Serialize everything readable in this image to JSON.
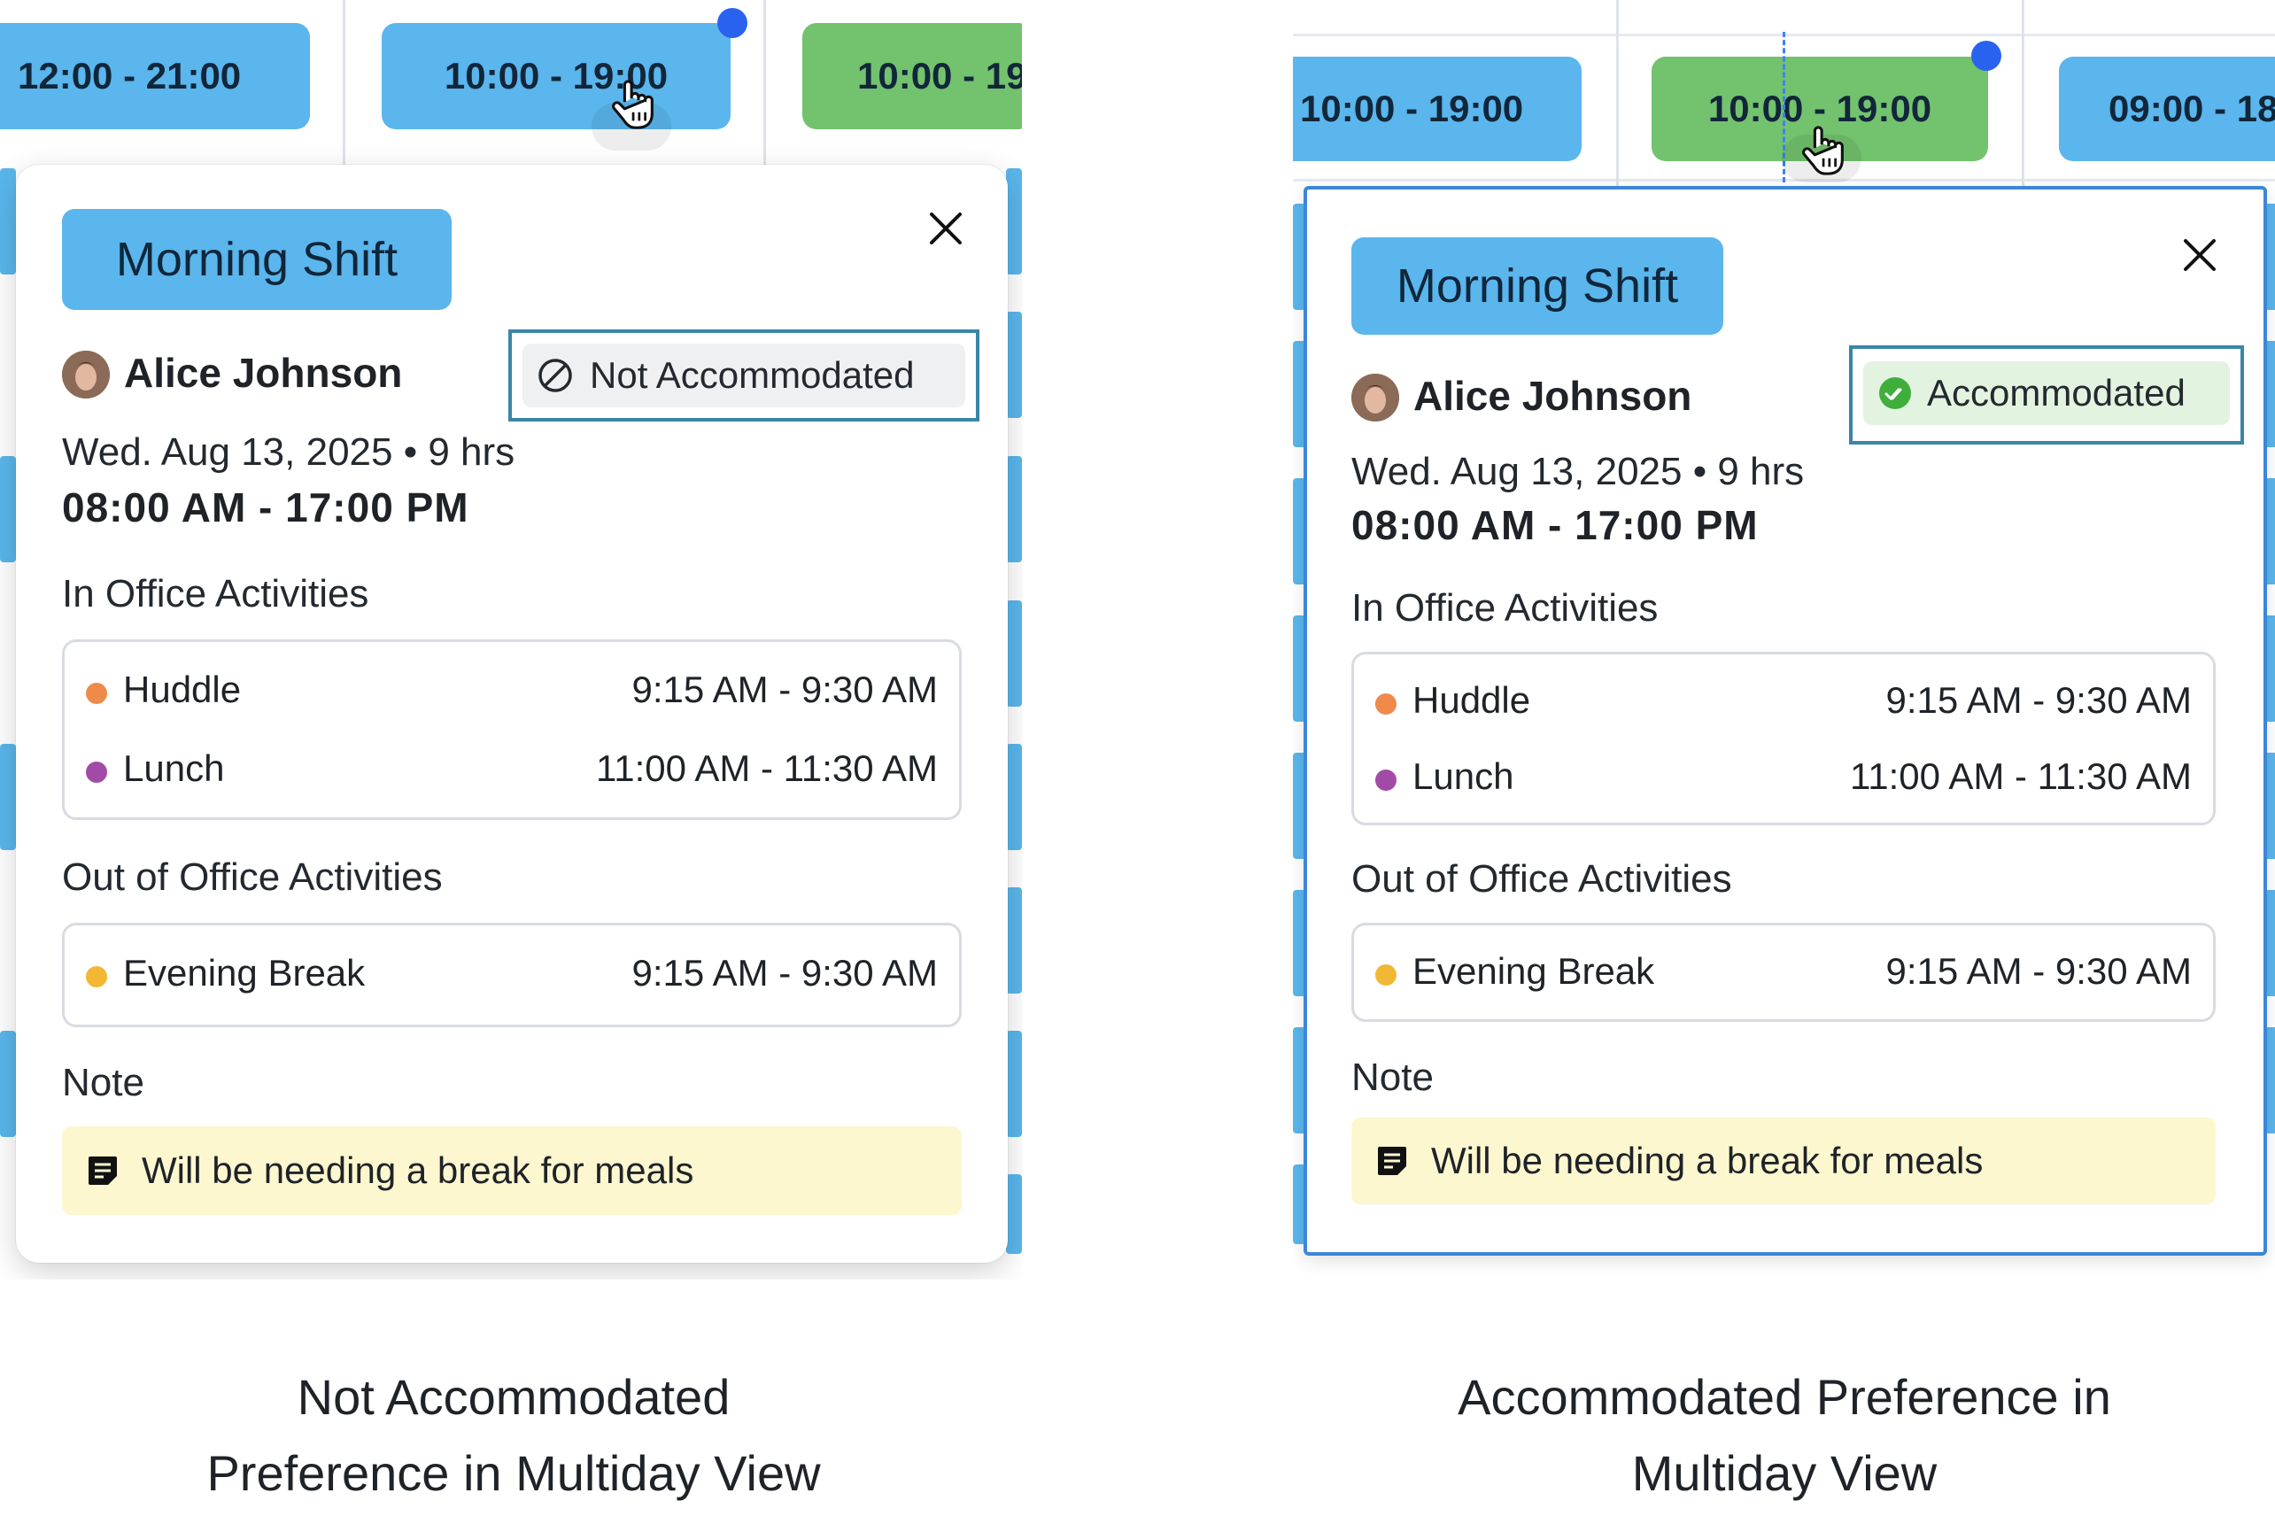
{
  "colors": {
    "shift_blue": "#5ab6ec",
    "shift_green": "#73c26e",
    "selected_dot": "#2a62f0",
    "huddle_dot": "#f08a4b",
    "lunch_dot": "#a24aa8",
    "evening_break_dot": "#f2b834",
    "note_bg": "#fdf7cf",
    "status_frame": "#3a86a6",
    "accommodated_check": "#3fae3a"
  },
  "left": {
    "calendar_chips": [
      "12:00 - 21:00",
      "10:00 - 19:00",
      "10:00 - 19"
    ],
    "popup": {
      "shift_name": "Morning Shift",
      "close_icon": "close-icon",
      "employee_name": "Alice Johnson",
      "status_icon": "prohibited-icon",
      "status_label": "Not Accommodated",
      "date_line": "Wed. Aug 13, 2025 • 9 hrs",
      "time_range": "08:00 AM - 17:00 PM",
      "in_office_title": "In Office Activities",
      "in_office": [
        {
          "name": "Huddle",
          "time": "9:15 AM - 9:30 AM"
        },
        {
          "name": "Lunch",
          "time": "11:00 AM - 11:30 AM"
        }
      ],
      "out_office_title": "Out of Office Activities",
      "out_office": [
        {
          "name": "Evening Break",
          "time": "9:15 AM - 9:30 AM"
        }
      ],
      "note_title": "Note",
      "note_text": "Will be needing a break for meals"
    },
    "caption": [
      "Not Accommodated",
      "Preference in Multiday View"
    ]
  },
  "right": {
    "calendar_chips": [
      "10:00 - 19:00",
      "10:00 - 19:00",
      "09:00 - 18"
    ],
    "popup": {
      "shift_name": "Morning Shift",
      "close_icon": "close-icon",
      "employee_name": "Alice Johnson",
      "status_icon": "check-circle-icon",
      "status_label": "Accommodated",
      "date_line": "Wed. Aug 13, 2025 • 9 hrs",
      "time_range": "08:00 AM - 17:00 PM",
      "in_office_title": "In Office Activities",
      "in_office": [
        {
          "name": "Huddle",
          "time": "9:15 AM - 9:30 AM"
        },
        {
          "name": "Lunch",
          "time": "11:00 AM - 11:30 AM"
        }
      ],
      "out_office_title": "Out of Office Activities",
      "out_office": [
        {
          "name": "Evening Break",
          "time": "9:15 AM - 9:30 AM"
        }
      ],
      "note_title": "Note",
      "note_text": "Will be needing a break for meals"
    },
    "caption": [
      "Accommodated Preference in",
      "Multiday View"
    ]
  }
}
